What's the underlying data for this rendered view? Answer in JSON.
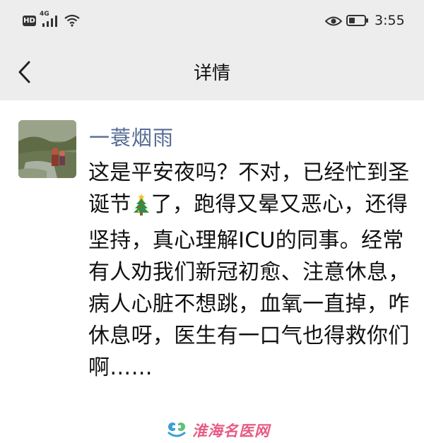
{
  "status_bar": {
    "hd": "HD",
    "network": "4G",
    "time": "3:55"
  },
  "header": {
    "title": "详情"
  },
  "post": {
    "author": "一蓑烟雨",
    "text_part1": "这是平安夜吗？不对，已经忙到圣诞节",
    "text_part2": "了，跑得又晕又恶心，还得坚持，真心理解ICU的同事。经常有人劝我们新冠初愈、注意休息，病人心脏不想跳，血氧一直掉，咋休息呀，医生有一口气也得救你们啊……"
  },
  "watermark": {
    "text": "淮海名医网"
  },
  "icons": {
    "back": "chevron-left-icon",
    "signal": "signal-icon",
    "wifi": "wifi-icon",
    "eye": "eye-icon",
    "battery": "battery-icon",
    "tree": "christmas-tree-icon"
  },
  "colors": {
    "header_bg": "#ededed",
    "author_name": "#576b95",
    "watermark": "#e85a84"
  }
}
